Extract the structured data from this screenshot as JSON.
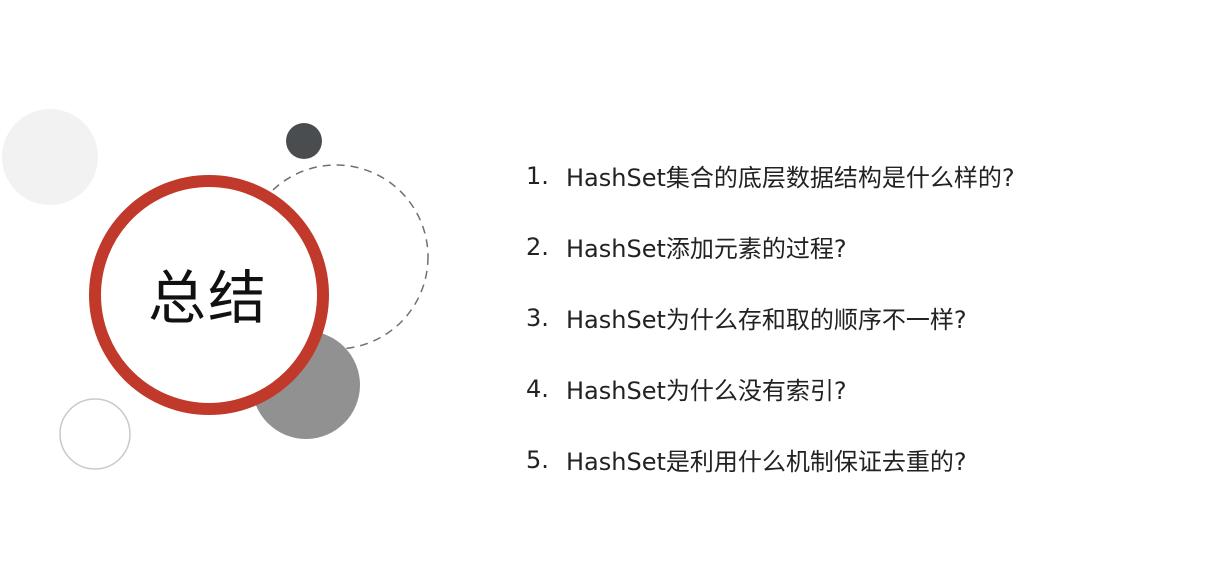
{
  "slide": {
    "title": "总结",
    "questions": [
      {
        "number": "1.",
        "text": "HashSet集合的底层数据结构是什么样的?"
      },
      {
        "number": "2.",
        "text": "HashSet添加元素的过程?"
      },
      {
        "number": "3.",
        "text": "HashSet为什么存和取的顺序不一样?"
      },
      {
        "number": "4.",
        "text": "HashSet为什么没有索引?"
      },
      {
        "number": "5.",
        "text": "HashSet是利用什么机制保证去重的?"
      }
    ]
  },
  "colors": {
    "accent_red": "#c0392b",
    "dark_gray": "#4a4d50",
    "mid_gray": "#919191",
    "light_gray": "#f2f2f2",
    "outline_gray": "#c9c9c9",
    "dashed_gray": "#707070"
  }
}
